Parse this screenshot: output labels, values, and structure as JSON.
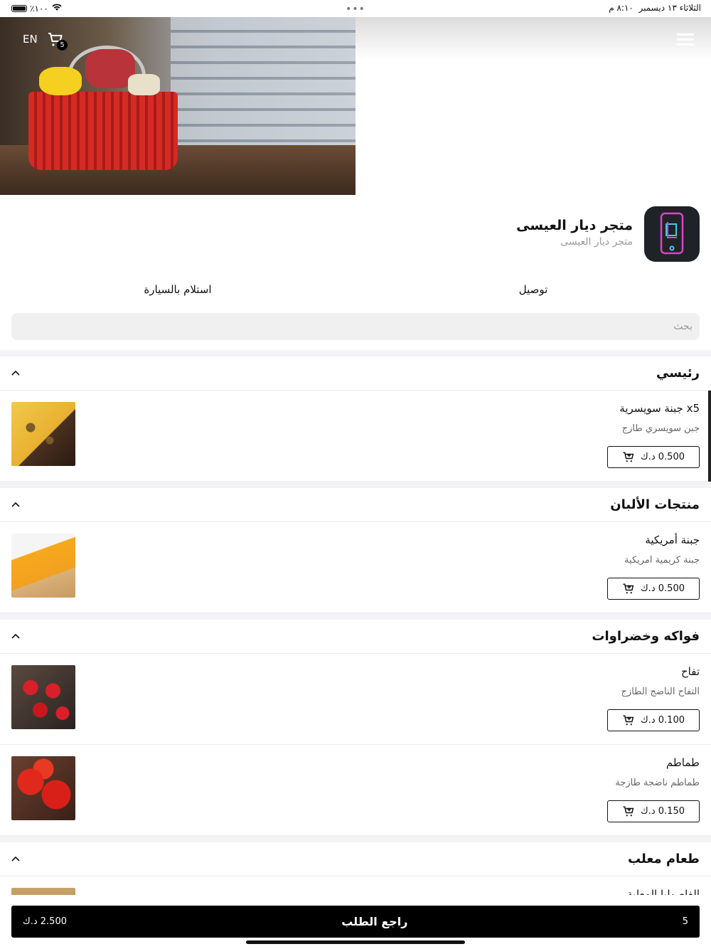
{
  "status_bar": {
    "time": "٨:١٠ م",
    "date": "الثلاثاء ١٣ ديسمبر",
    "battery": "٪١٠٠"
  },
  "header": {
    "language_toggle": "EN",
    "cart_count": "5"
  },
  "store": {
    "name": "متجر ديار العيسى",
    "subtitle": "متجر ديار العيسى"
  },
  "order_modes": {
    "delivery": "توصيل",
    "pickup": "استلام بالسيارة"
  },
  "search": {
    "placeholder": "بحث"
  },
  "sections": [
    {
      "title": "رئيسي",
      "items": [
        {
          "name": "x5 جبنة سويسرية",
          "description": "جبن سويسري طازج",
          "price": "0.500 د.ك"
        }
      ]
    },
    {
      "title": "منتجات الألبان",
      "items": [
        {
          "name": "جبنة أمريكية",
          "description": "جبنة كريمية امريكية",
          "price": "0.500 د.ك"
        }
      ]
    },
    {
      "title": "فواكه وخضراوات",
      "items": [
        {
          "name": "تفاح",
          "description": "التفاح الناضج الطازج",
          "price": "0.100 د.ك"
        },
        {
          "name": "طماطم",
          "description": "طماطم ناضجة طازجة",
          "price": "0.150 د.ك"
        }
      ]
    },
    {
      "title": "طعام معلب",
      "items": [
        {
          "name": "الفاصوليا المعلبة",
          "description": "",
          "price": ""
        }
      ]
    }
  ],
  "checkout_bar": {
    "count": "5",
    "label": "راجع الطلب",
    "total": "2.500 د.ك"
  },
  "colors": {
    "primary": "#000000",
    "section_bg": "#f3f3f5",
    "muted_text": "#9a9a9a"
  }
}
